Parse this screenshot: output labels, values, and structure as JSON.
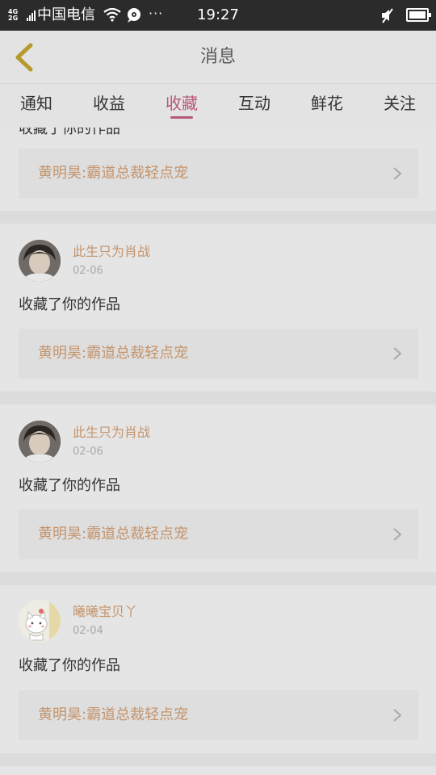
{
  "status_bar": {
    "network_top": "4G",
    "network_bottom": "2G",
    "carrier": "中国电信",
    "more": "···",
    "time": "19:27"
  },
  "header": {
    "title": "消息"
  },
  "tabs": [
    {
      "label": "通知"
    },
    {
      "label": "收益"
    },
    {
      "label": "收藏"
    },
    {
      "label": "互动"
    },
    {
      "label": "鲜花"
    },
    {
      "label": "关注"
    }
  ],
  "active_tab": "收藏",
  "colors": {
    "accent": "#b8577a",
    "name_color": "#c4946c"
  },
  "partial_item": {
    "action": "收藏了你的作品",
    "work_title": "黄明昊:霸道总裁轻点宠"
  },
  "items": [
    {
      "user": "此生只为肖战",
      "date": "02-06",
      "action": "收藏了你的作品",
      "work_title": "黄明昊:霸道总裁轻点宠",
      "avatar": "boy-photo-avatar"
    },
    {
      "user": "此生只为肖战",
      "date": "02-06",
      "action": "收藏了你的作品",
      "work_title": "黄明昊:霸道总裁轻点宠",
      "avatar": "boy-photo-avatar"
    },
    {
      "user": "曦曦宝贝丫",
      "date": "02-04",
      "action": "收藏了你的作品",
      "work_title": "黄明昊:霸道总裁轻点宠",
      "avatar": "cartoon-cat-avatar"
    }
  ]
}
